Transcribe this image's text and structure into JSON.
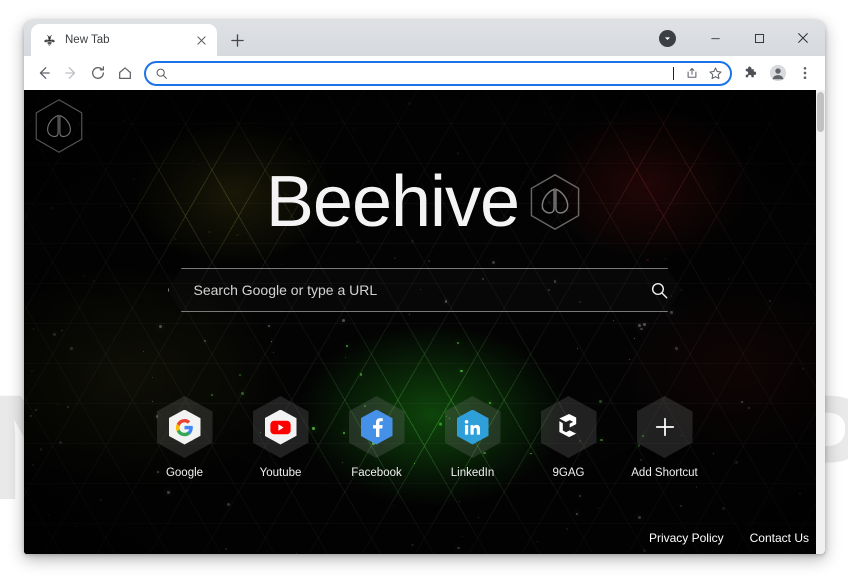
{
  "window": {
    "tab": {
      "title": "New Tab",
      "favicon_icon": "bee-icon",
      "close_icon": "close-icon"
    },
    "newtab_button_icon": "plus-icon",
    "controls": {
      "download_icon": "download-chevron-icon",
      "minimize_icon": "minimize-icon",
      "maximize_icon": "maximize-icon",
      "close_icon": "close-icon"
    }
  },
  "toolbar": {
    "back_icon": "back-arrow-icon",
    "forward_icon": "forward-arrow-icon",
    "reload_icon": "reload-icon",
    "home_icon": "home-icon",
    "omnibox": {
      "search_icon": "search-icon",
      "value": "",
      "placeholder": ""
    },
    "share_icon": "share-icon",
    "bookmark_icon": "star-icon",
    "extensions_icon": "puzzle-piece-icon",
    "profile_icon": "account-avatar-icon",
    "menu_icon": "three-dot-menu-icon"
  },
  "page": {
    "corner_logo_icon": "beehive-hex-logo-icon",
    "brand_title": "Beehive",
    "brand_logo_icon": "beehive-hex-logo-icon",
    "search": {
      "value": "",
      "placeholder": "Search Google or type a URL",
      "submit_icon": "magnifier-icon"
    },
    "shortcuts": [
      {
        "label": "Google",
        "icon": "google-g-icon",
        "tile": "white"
      },
      {
        "label": "Youtube",
        "icon": "youtube-icon",
        "tile": "white"
      },
      {
        "label": "Facebook",
        "icon": "facebook-f-icon",
        "tile": "fb"
      },
      {
        "label": "LinkedIn",
        "icon": "linkedin-in-icon",
        "tile": "li"
      },
      {
        "label": "9GAG",
        "icon": "ninegag-icon",
        "tile": "none"
      },
      {
        "label": "Add Shortcut",
        "icon": "plus-icon",
        "tile": "none"
      }
    ],
    "footer": {
      "privacy_label": "Privacy Policy",
      "contact_label": "Contact Us"
    }
  },
  "desktop": {
    "watermark_left": "N",
    "watermark_right": "P"
  },
  "colors": {
    "omnibox_focus": "#1a73e8",
    "page_background": "#030303",
    "glow_green": "#3cff28",
    "glow_red": "#dc1e1e",
    "glow_yellow": "#e6dc3c",
    "facebook_blue": "#4591e8",
    "linkedin_blue": "#2f9fd9",
    "text_light": "#f1f1f1"
  }
}
